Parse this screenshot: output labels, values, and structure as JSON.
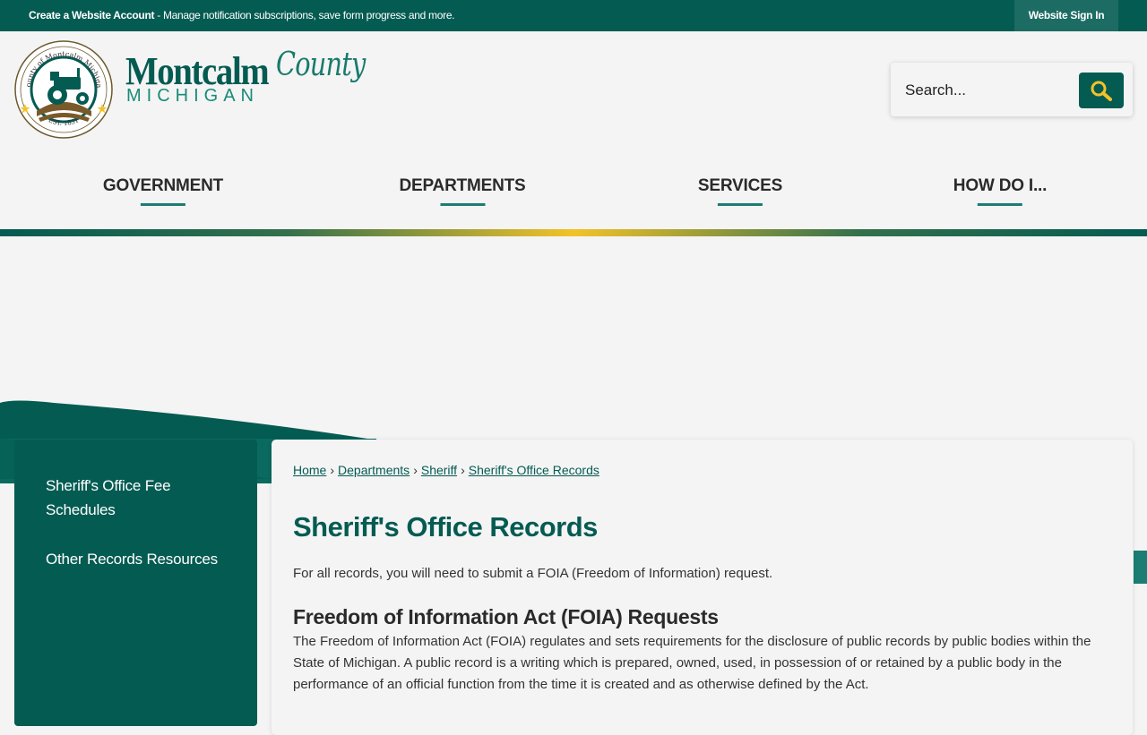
{
  "topbar": {
    "create_account_label": "Create a Website Account",
    "create_account_desc": " - Manage notification subscriptions, save form progress and more.",
    "sign_in_label": "Website Sign In"
  },
  "logo": {
    "seal_text_top": "County of Montcalm Michigan",
    "seal_text_bottom": "EST. 1831",
    "wordmark_main": "Montcalm",
    "wordmark_script": "County",
    "wordmark_sub": "MICHIGAN"
  },
  "search": {
    "placeholder": "Search...",
    "button_icon": "search-icon"
  },
  "nav": {
    "items": [
      {
        "label": "GOVERNMENT"
      },
      {
        "label": "DEPARTMENTS"
      },
      {
        "label": "SERVICES"
      },
      {
        "label": "HOW DO I..."
      }
    ]
  },
  "sidebar": {
    "items": [
      {
        "label": "Sheriff's Office Fee Schedules"
      },
      {
        "label": "Other Records Resources"
      }
    ]
  },
  "breadcrumb": {
    "items": [
      "Home",
      "Departments",
      "Sheriff",
      "Sheriff's Office Records"
    ],
    "separator": "›"
  },
  "main": {
    "title": "Sheriff's Office Records",
    "intro": "For all records, you will need to submit a FOIA (Freedom of Information) request.",
    "section_heading": "Freedom of Information Act (FOIA) Requests",
    "section_body": "The Freedom of Information Act (FOIA) regulates and sets requirements for the disclosure of public records by public bodies within the State of Michigan. A public record is a writing which is prepared, owned, used, in possession of or retained by a public body in the performance of an official function from the time it is created and as otherwise defined by the Act."
  },
  "colors": {
    "primary": "#045b52",
    "accent": "#f3c229",
    "background": "#f4f4f4"
  }
}
